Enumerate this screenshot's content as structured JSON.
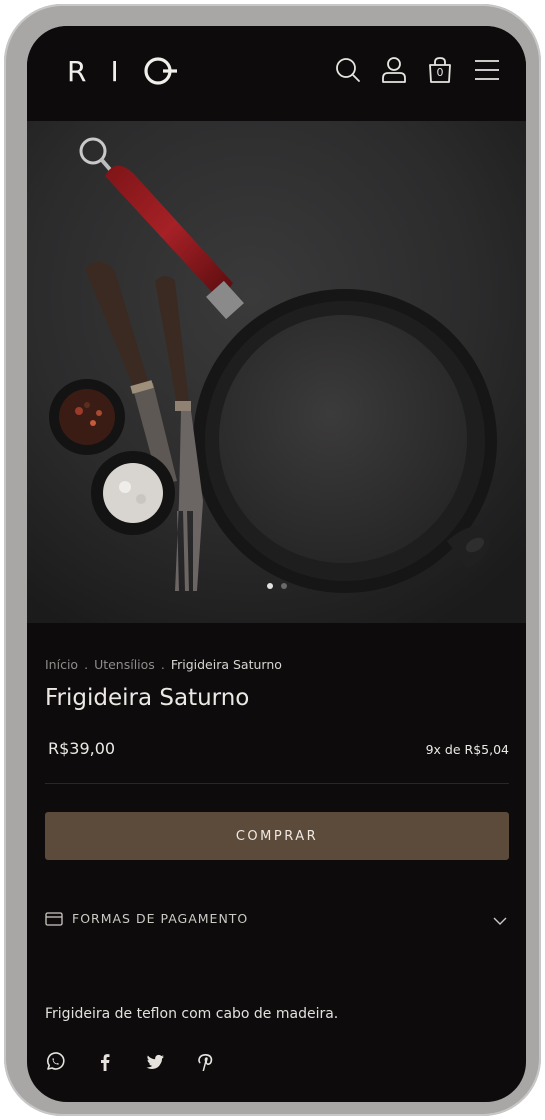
{
  "header": {
    "logo_letters": [
      "R",
      "I"
    ],
    "icons": [
      "search-icon",
      "user-icon",
      "cart-icon",
      "menu-icon"
    ],
    "cart_count": "0"
  },
  "gallery": {
    "slides": 2,
    "active": 1,
    "image": "frying-pan-with-utensils"
  },
  "breadcrumb": {
    "items": [
      "Início",
      "Utensílios",
      "Frigideira Saturno"
    ],
    "separator": "."
  },
  "product": {
    "title": "Frigideira Saturno",
    "price": "R$39,00",
    "installments": "9x de R$5,04",
    "buy_label": "COMPRAR",
    "payment_label": "FORMAS DE PAGAMENTO",
    "description": "Frigideira de teflon com cabo de madeira."
  },
  "social": [
    "whatsapp-icon",
    "facebook-icon",
    "twitter-icon",
    "pinterest-icon"
  ],
  "colors": {
    "background": "#0d0b0c",
    "buy_button": "#5c4a3a",
    "text": "#ece9e5",
    "muted": "#8f8c89",
    "device_frame": "#a8a7a5"
  }
}
